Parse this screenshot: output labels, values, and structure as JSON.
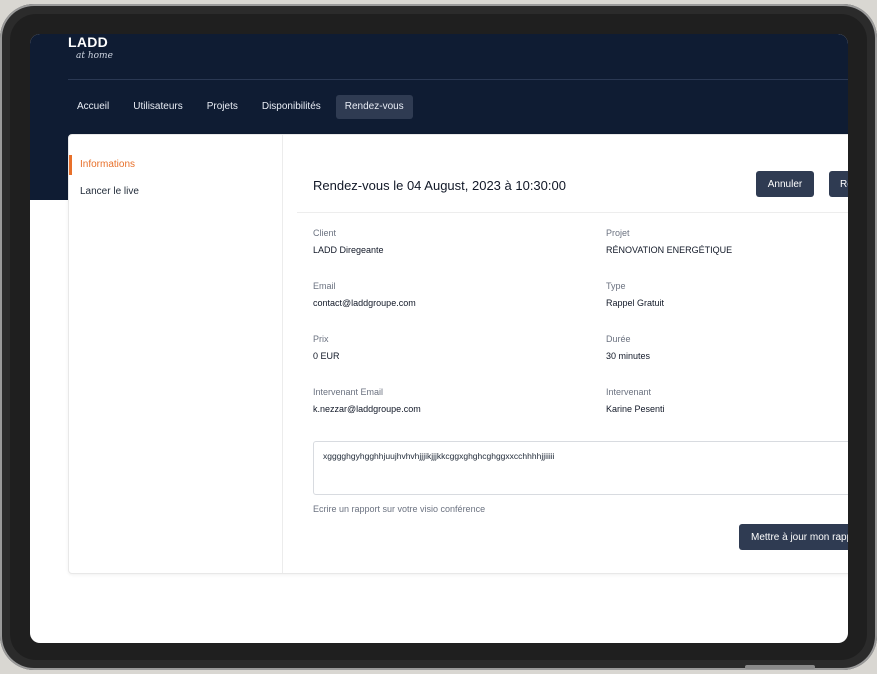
{
  "header": {
    "logo": "LADD",
    "logo_sub": "at home"
  },
  "nav": {
    "items": [
      {
        "label": "Accueil"
      },
      {
        "label": "Utilisateurs"
      },
      {
        "label": "Projets"
      },
      {
        "label": "Disponibilités"
      },
      {
        "label": "Rendez-vous",
        "active": true
      }
    ]
  },
  "sidebar": {
    "items": [
      {
        "label": "Informations",
        "active": true
      },
      {
        "label": "Lancer le live"
      }
    ]
  },
  "appointment": {
    "title": "Rendez-vous le 04 August, 2023 à 10:30:00",
    "cancel_label": "Annuler",
    "second_button_label": "Re",
    "fields": {
      "client_label": "Client",
      "client_value": "LADD Diregeante",
      "projet_label": "Projet",
      "projet_value": "RÉNOVATION ENERGÉTIQUE",
      "email_label": "Email",
      "email_value": "contact@laddgroupe.com",
      "type_label": "Type",
      "type_value": "Rappel Gratuit",
      "prix_label": "Prix",
      "prix_value": "0 EUR",
      "duree_label": "Durée",
      "duree_value": "30 minutes",
      "intervenant_email_label": "Intervenant Email",
      "intervenant_email_value": "k.nezzar@laddgroupe.com",
      "intervenant_label": "Intervenant",
      "intervenant_value": "Karine Pesenti"
    },
    "report_text": "xgggghgyhgghhjuujhvhvhjjjikjjjkkcggxghghcghggxxcchhhhjjiiiii",
    "report_hint": "Ecrire un rapport sur votre visio conférence",
    "update_button_label": "Mettre à jour mon rapport"
  },
  "colors": {
    "header_bg": "#0f1c33",
    "accent": "#e8702a",
    "button_bg": "#2f3b52"
  }
}
